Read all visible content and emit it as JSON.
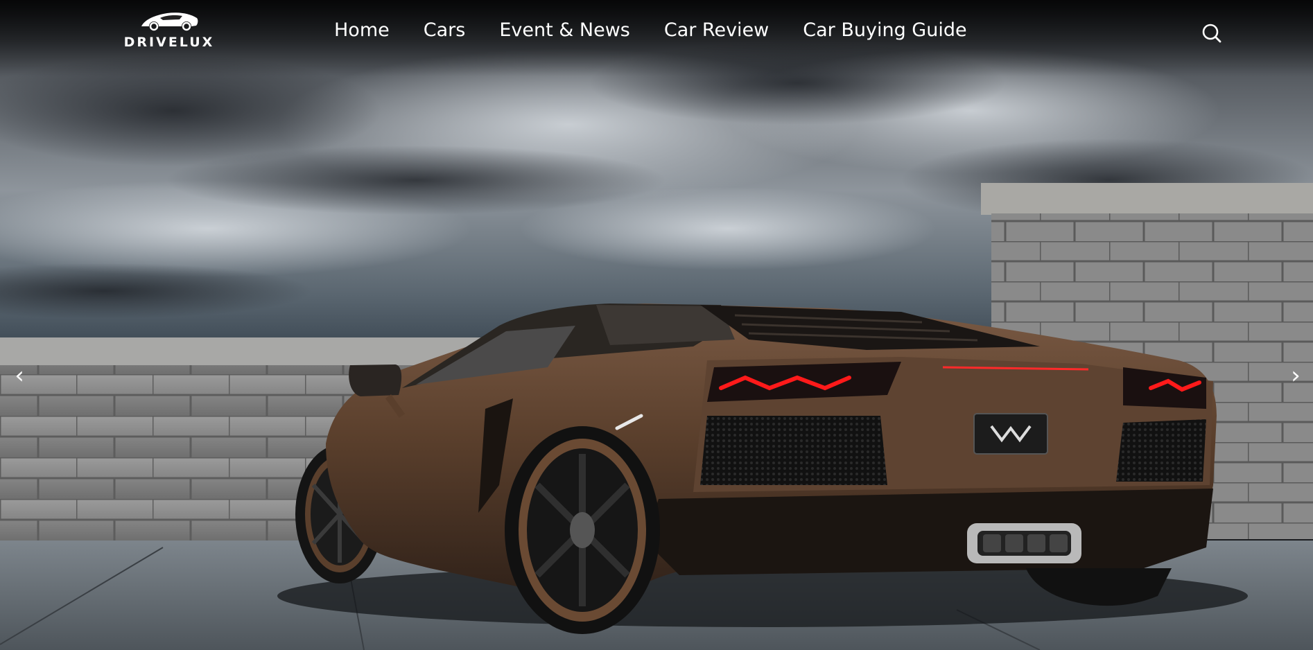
{
  "brand": {
    "name": "DRIVELUX",
    "logo_icon": "sports-car-logo-icon"
  },
  "nav": {
    "items": [
      {
        "label": "Home"
      },
      {
        "label": "Cars"
      },
      {
        "label": "Event & News"
      },
      {
        "label": "Car Review"
      },
      {
        "label": "Car Buying Guide"
      }
    ],
    "search_icon": "search-icon"
  },
  "slider": {
    "prev_label": "‹",
    "next_label": "›",
    "image_subject": "brown-supercar-rear-three-quarter-rooftop"
  },
  "colors": {
    "nav_text": "#ffffff",
    "car_body": "#5a3f2c",
    "taillight": "#ff1a1a",
    "sky": "#9aa0a6",
    "wall": "#8c8c8c"
  }
}
